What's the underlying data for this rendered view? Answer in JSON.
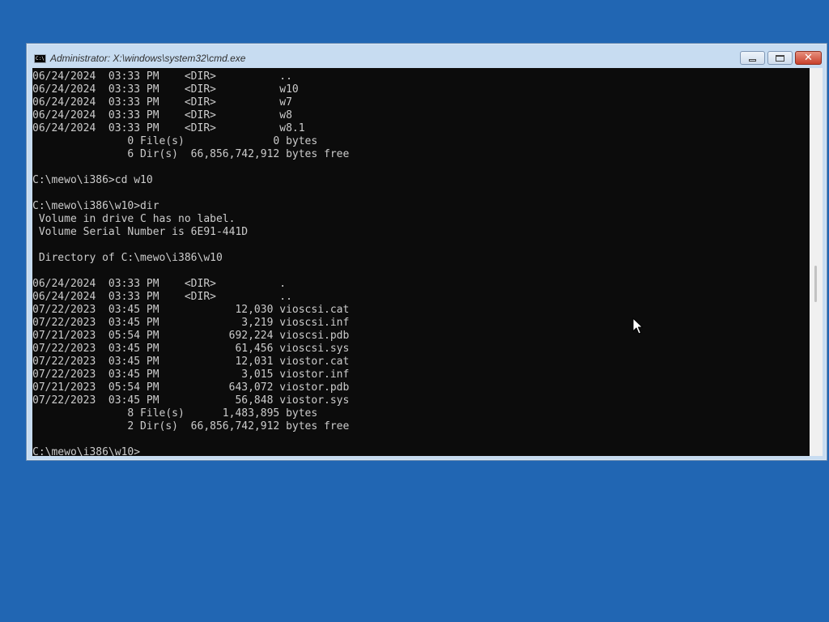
{
  "window": {
    "title": "Administrator: X:\\windows\\system32\\cmd.exe",
    "icon_text": "C:\\",
    "close_glyph": "✕"
  },
  "console": {
    "lines": [
      "06/24/2024  03:33 PM    <DIR>          ..",
      "06/24/2024  03:33 PM    <DIR>          w10",
      "06/24/2024  03:33 PM    <DIR>          w7",
      "06/24/2024  03:33 PM    <DIR>          w8",
      "06/24/2024  03:33 PM    <DIR>          w8.1",
      "               0 File(s)              0 bytes",
      "               6 Dir(s)  66,856,742,912 bytes free",
      "",
      "C:\\mewo\\i386>cd w10",
      "",
      "C:\\mewo\\i386\\w10>dir",
      " Volume in drive C has no label.",
      " Volume Serial Number is 6E91-441D",
      "",
      " Directory of C:\\mewo\\i386\\w10",
      "",
      "06/24/2024  03:33 PM    <DIR>          .",
      "06/24/2024  03:33 PM    <DIR>          ..",
      "07/22/2023  03:45 PM            12,030 vioscsi.cat",
      "07/22/2023  03:45 PM             3,219 vioscsi.inf",
      "07/21/2023  05:54 PM           692,224 vioscsi.pdb",
      "07/22/2023  03:45 PM            61,456 vioscsi.sys",
      "07/22/2023  03:45 PM            12,031 viostor.cat",
      "07/22/2023  03:45 PM             3,015 viostor.inf",
      "07/21/2023  05:54 PM           643,072 viostor.pdb",
      "07/22/2023  03:45 PM            56,848 viostor.sys",
      "               8 File(s)      1,483,895 bytes",
      "               2 Dir(s)  66,856,742,912 bytes free",
      "",
      "C:\\mewo\\i386\\w10>"
    ]
  }
}
